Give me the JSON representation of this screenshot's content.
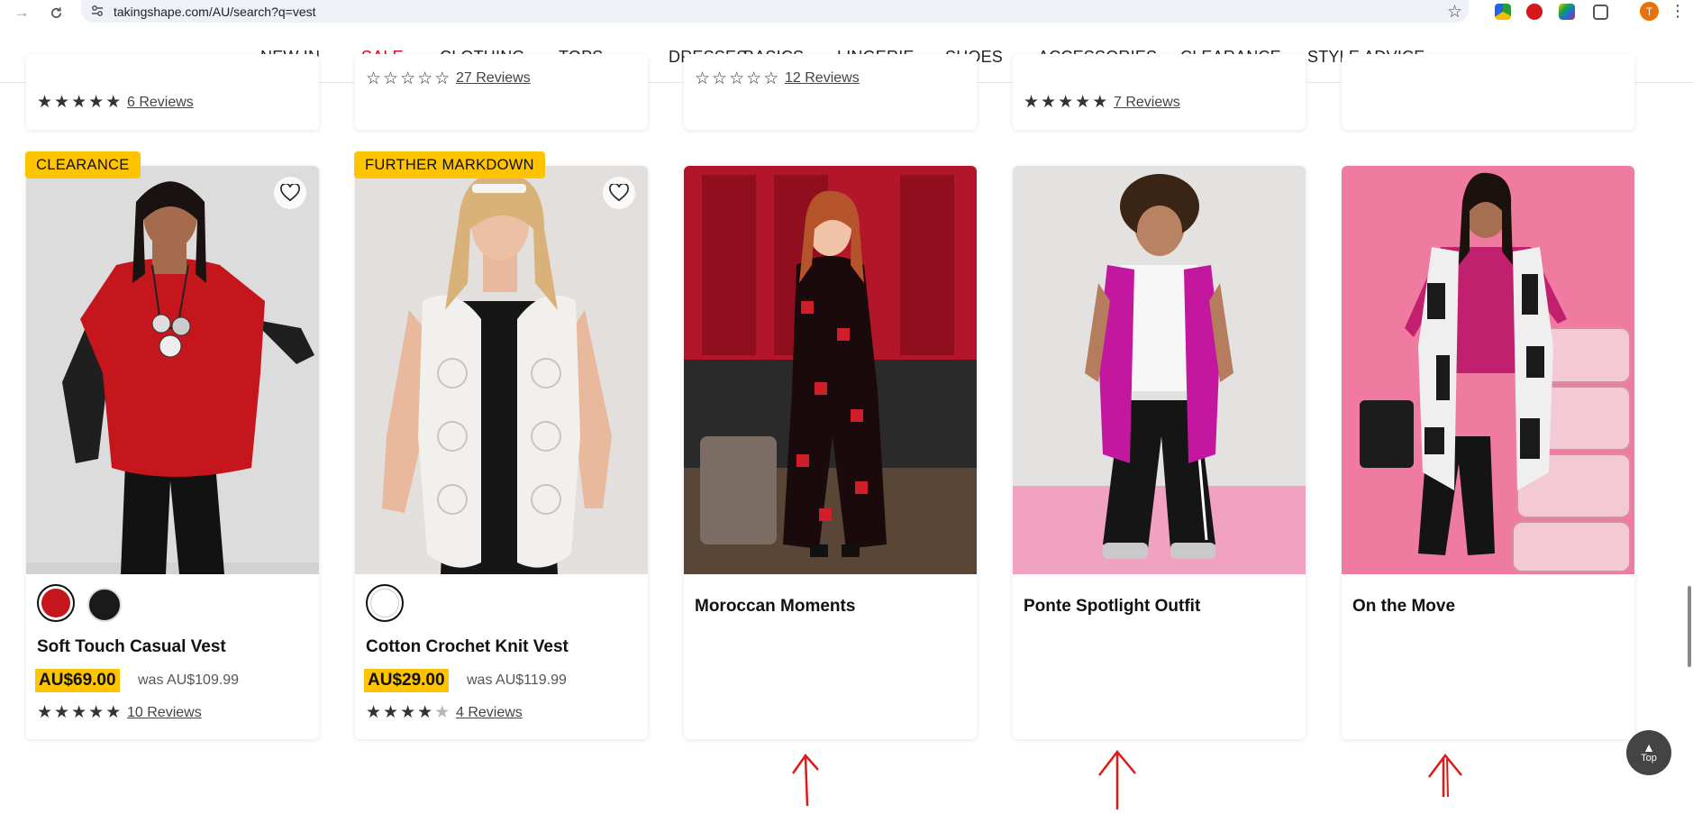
{
  "browser": {
    "url": "takingshape.com/AU/search?q=vest",
    "avatar_initial": "T"
  },
  "nav": {
    "items": [
      {
        "label": "NEW IN"
      },
      {
        "label": "SALE"
      },
      {
        "label": "CLOTHING"
      },
      {
        "label": "TOPS"
      },
      {
        "label": "DRESSES"
      },
      {
        "label": "BASICS"
      },
      {
        "label": "LINGERIE"
      },
      {
        "label": "SHOES"
      },
      {
        "label": "ACCESSORIES"
      },
      {
        "label": "CLEARANCE"
      },
      {
        "label": "STYLE ADVICE"
      }
    ],
    "sale_color": "#e3001b"
  },
  "top_row": [
    {
      "rating": 5,
      "reviews": "6 Reviews"
    },
    {
      "rating": 5,
      "reviews": "27 Reviews"
    },
    {
      "rating": 5,
      "reviews": "12 Reviews"
    },
    {
      "rating": 5,
      "reviews": "7 Reviews"
    },
    {}
  ],
  "products": [
    {
      "badge": "CLEARANCE",
      "title": "Soft Touch Casual Vest",
      "price": "AU$69.00",
      "was_price": "was AU$109.99",
      "rating": 5,
      "reviews": "10 Reviews",
      "swatches": [
        "#c4161c",
        "#1a1a1a"
      ]
    },
    {
      "badge": "FURTHER MARKDOWN",
      "title": "Cotton Crochet Knit Vest",
      "price": "AU$29.00",
      "was_price": "was AU$119.99",
      "rating": 4,
      "reviews": "4 Reviews",
      "swatches": [
        "#ffffff"
      ]
    }
  ],
  "looks": [
    {
      "title": "Moroccan Moments"
    },
    {
      "title": "Ponte Spotlight Outfit"
    },
    {
      "title": "On the Move"
    }
  ],
  "back_to_top": "Top",
  "colors": {
    "badge": "#ffc400",
    "annotation_arrow": "#e01818"
  }
}
